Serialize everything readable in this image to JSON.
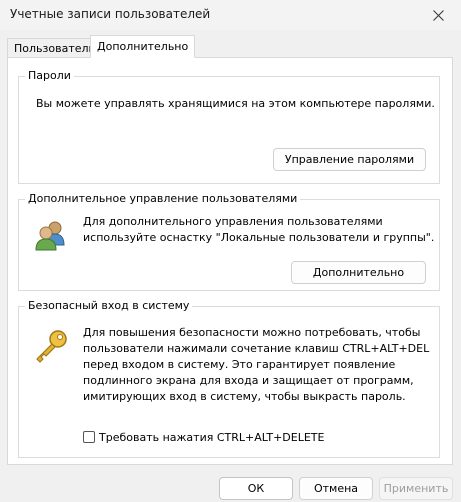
{
  "window": {
    "title": "Учетные записи пользователей"
  },
  "tabs": [
    {
      "label": "Пользователи",
      "active": false
    },
    {
      "label": "Дополнительно",
      "active": true
    }
  ],
  "passwords": {
    "title": "Пароли",
    "description": "Вы можете управлять хранящимися на этом компьютере паролями.",
    "button": "Управление паролями"
  },
  "advanced_users": {
    "title": "Дополнительное управление пользователями",
    "description_line1": "Для дополнительного управления пользователями",
    "description_line2": "используйте оснастку \"Локальные пользователи и группы\".",
    "button": "Дополнительно",
    "icon": "users-icon"
  },
  "secure_logon": {
    "title": "Безопасный вход в систему",
    "lines": [
      "Для повышения безопасности можно потребовать, чтобы",
      "пользователи нажимали сочетание клавиш CTRL+ALT+DEL",
      "перед входом в систему. Это гарантирует появление",
      "подлинного экрана для входа и защищает от программ,",
      "имитирующих вход в систему, чтобы выкрасть пароль."
    ],
    "checkbox_label": "Требовать нажатия CTRL+ALT+DELETE",
    "checkbox_checked": false,
    "icon": "key-icon"
  },
  "footer": {
    "ok": "ОК",
    "cancel": "Отмена",
    "apply": "Применить",
    "apply_enabled": false
  }
}
